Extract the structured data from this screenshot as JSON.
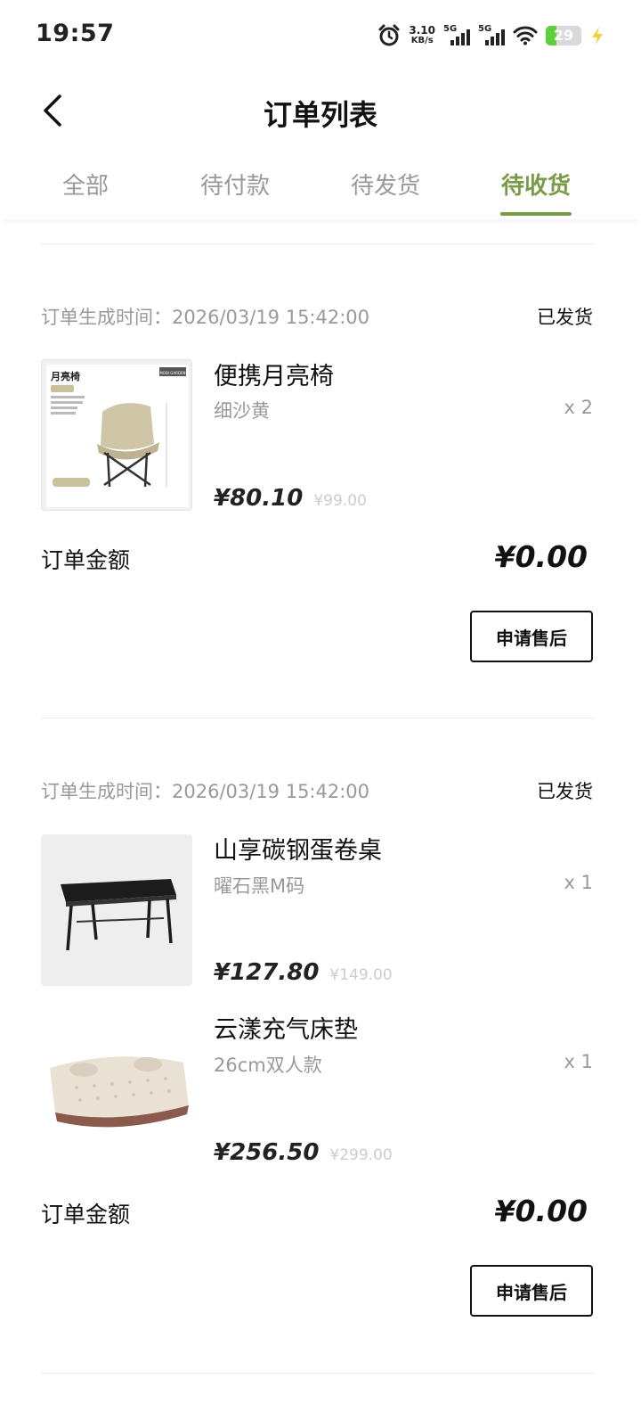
{
  "status_bar": {
    "time": "19:57",
    "net_speed_value": "3.10",
    "net_speed_unit": "KB/s",
    "sim1": "5G",
    "sim2": "5G",
    "battery_level": "29"
  },
  "header": {
    "title": "订单列表"
  },
  "tabs": [
    {
      "label": "全部",
      "active": false
    },
    {
      "label": "待付款",
      "active": false
    },
    {
      "label": "待发货",
      "active": false
    },
    {
      "label": "待收货",
      "active": true
    }
  ],
  "colors": {
    "accent": "#7a9a46",
    "battery_fill": "#5dd13a",
    "muted_text": "#999999"
  },
  "orders": [
    {
      "time": "订单生成时间：2026/03/19 15:42:00",
      "status": "已发货",
      "items": [
        {
          "name": "便携月亮椅",
          "spec": "细沙黄",
          "qty": "x 2",
          "price": "¥80.10",
          "orig_price": "¥99.00",
          "image_label": "月亮椅",
          "image_brand": "MOBI GARDEN"
        }
      ],
      "total_label": "订单金额",
      "total": "¥0.00",
      "button": "申请售后"
    },
    {
      "time": "订单生成时间：2026/03/19 15:42:00",
      "status": "已发货",
      "items": [
        {
          "name": "山享碳钢蛋卷桌",
          "spec": "曜石黑M码",
          "qty": "x 1",
          "price": "¥127.80",
          "orig_price": "¥149.00"
        },
        {
          "name": "云漾充气床垫",
          "spec": "26cm双人款",
          "qty": "x 1",
          "price": "¥256.50",
          "orig_price": "¥299.00"
        }
      ],
      "total_label": "订单金额",
      "total": "¥0.00",
      "button": "申请售后"
    }
  ]
}
